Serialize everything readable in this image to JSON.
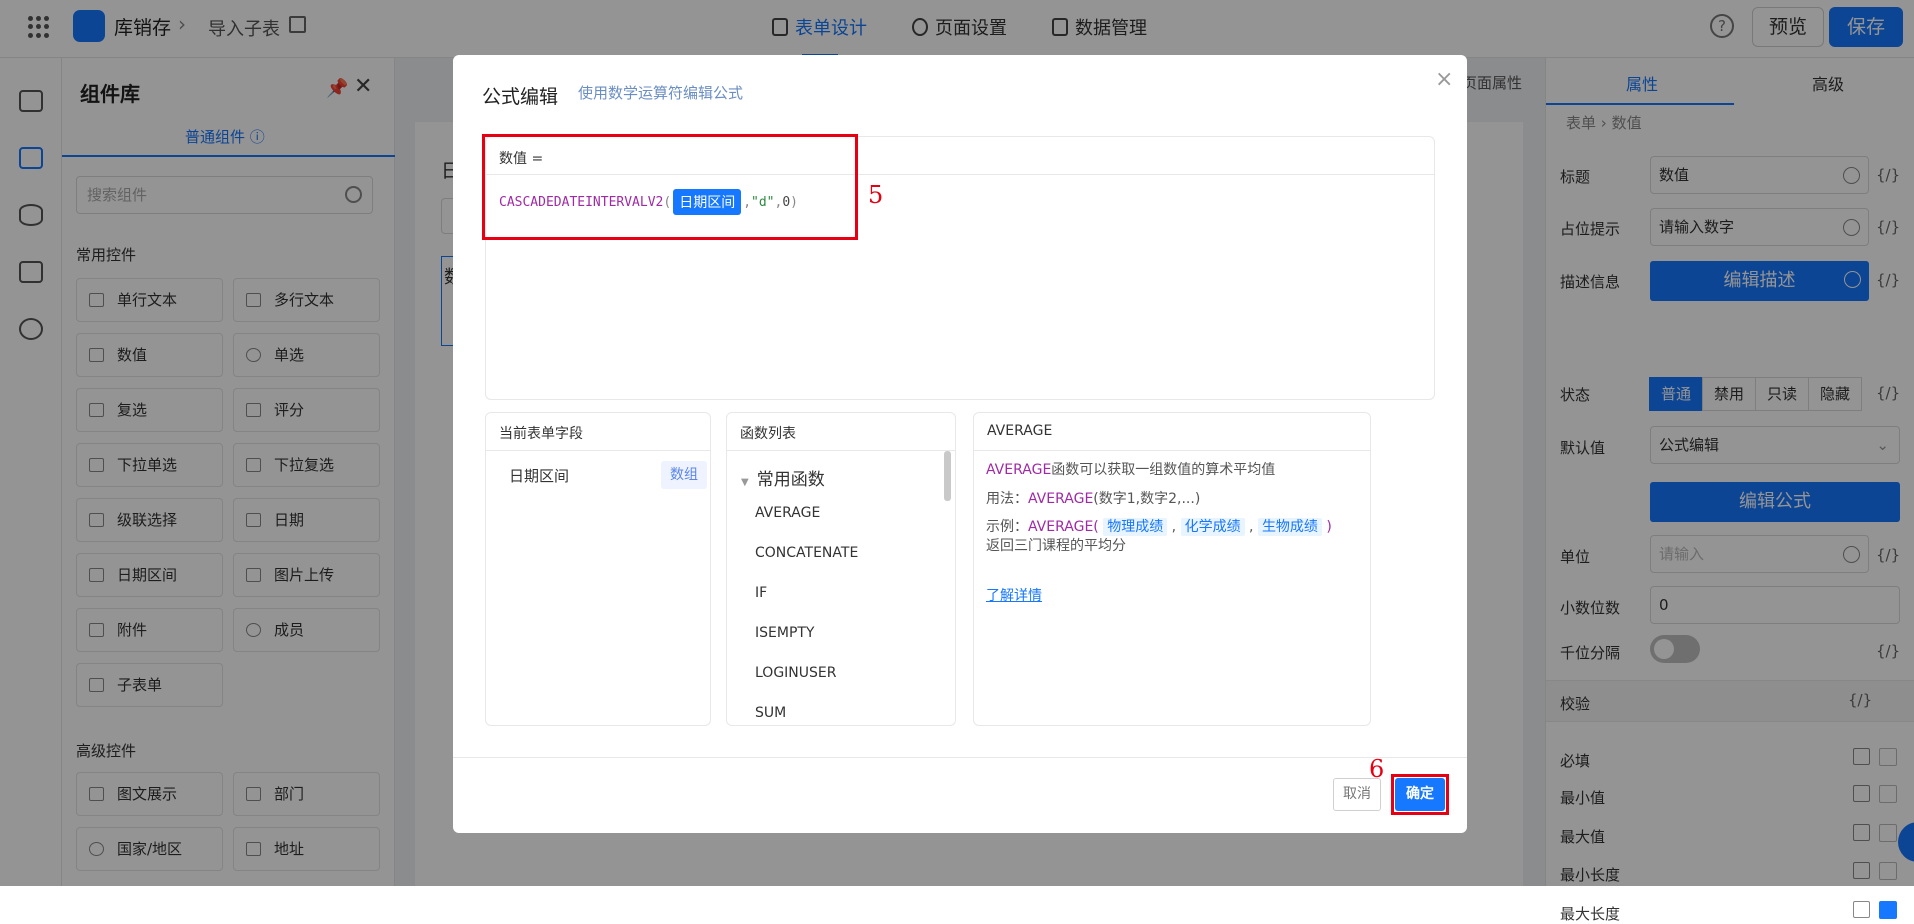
{
  "topbar": {
    "app_name": "库销存",
    "breadcrumb_sep": "›",
    "breadcrumb_page": "导入子表",
    "nav": [
      "表单设计",
      "页面设置",
      "数据管理"
    ],
    "help": "?",
    "preview": "预览",
    "save": "保存"
  },
  "components": {
    "title": "组件库",
    "pin": "📌",
    "close": "✕",
    "tab": "普通组件 ⓘ",
    "search_placeholder": "搜索组件",
    "common_title": "常用控件",
    "common": [
      "单行文本",
      "多行文本",
      "数值",
      "单选",
      "复选",
      "评分",
      "下拉单选",
      "下拉复选",
      "级联选择",
      "日期",
      "日期区间",
      "图片上传",
      "附件",
      "成员",
      "子表单"
    ],
    "advanced_title": "高级控件",
    "advanced": [
      "图文展示",
      "部门",
      "国家/地区",
      "地址"
    ]
  },
  "canvas": {
    "page_props": "页面属性",
    "partial1": "日",
    "partial2": "数"
  },
  "props": {
    "tabs": [
      "属性",
      "高级"
    ],
    "breadcrumb": [
      "表单",
      "›",
      "数值"
    ],
    "labels": {
      "title": "标题",
      "placeholder": "占位提示",
      "description": "描述信息",
      "state": "状态",
      "default": "默认值",
      "unit": "单位",
      "decimals": "小数位数",
      "thousands": "千位分隔",
      "validation": "校验"
    },
    "title_value": "数值",
    "placeholder_value": "请输入数字",
    "edit_desc_btn": "编辑描述",
    "states": [
      "普通",
      "禁用",
      "只读",
      "隐藏"
    ],
    "default_value": "公式编辑",
    "edit_formula_btn": "编辑公式",
    "unit_placeholder": "请输入",
    "decimals_value": "0",
    "fx": "{/}",
    "validation_items": [
      "必填",
      "最小值",
      "最大值",
      "最小长度",
      "最大长度"
    ]
  },
  "modal": {
    "title": "公式编辑",
    "subtitle": "使用数学运算符编辑公式",
    "close": "×",
    "editor_label": "数值 =",
    "formula": {
      "func": "CASCADEDATEINTERVALV2",
      "open": "(",
      "field": "日期区间",
      "sep1": ",",
      "str": "\"d\"",
      "sep2": ",",
      "num": "0",
      "close": ")"
    },
    "fields_header": "当前表单字段",
    "field_name": "日期区间",
    "field_type": "数组",
    "functions_header": "函数列表",
    "function_category": "常用函数",
    "functions": [
      "AVERAGE",
      "CONCATENATE",
      "IF",
      "ISEMPTY",
      "LOGINUSER",
      "SUM"
    ],
    "desc_header": "AVERAGE",
    "desc": {
      "fname": "AVERAGE",
      "summary": "函数可以获取一组数值的算术平均值",
      "usage_label": "用法：",
      "usage_func": "AVERAGE",
      "usage_args": "(数字1,数字2,...)",
      "example_label": "示例：",
      "example_func": "AVERAGE",
      "open": "(",
      "p1": "物理成绩",
      "p2": "化学成绩",
      "p3": "生物成绩",
      "comma": ",",
      "close": ")",
      "result": "返回三门课程的平均分",
      "link": "了解详情"
    },
    "cancel": "取消",
    "ok": "确定"
  },
  "annotations": {
    "a5": "5",
    "a6": "6"
  }
}
